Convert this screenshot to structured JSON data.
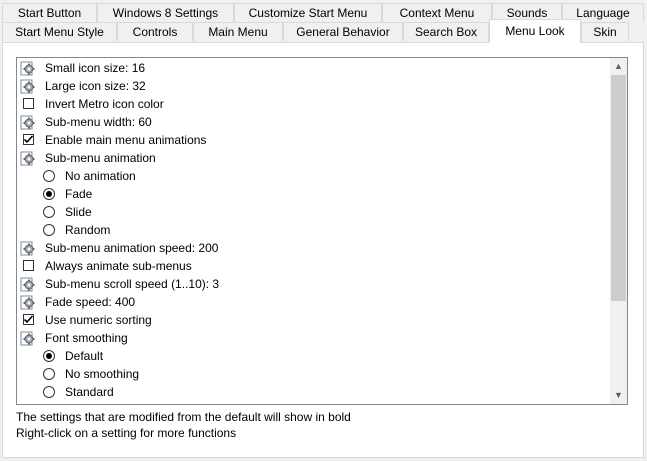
{
  "tabs_top": [
    {
      "label": "Start Button"
    },
    {
      "label": "Windows 8 Settings"
    },
    {
      "label": "Customize Start Menu"
    },
    {
      "label": "Context Menu"
    },
    {
      "label": "Sounds"
    },
    {
      "label": "Language"
    }
  ],
  "tabs_bottom": [
    {
      "label": "Start Menu Style"
    },
    {
      "label": "Controls"
    },
    {
      "label": "Main Menu"
    },
    {
      "label": "General Behavior"
    },
    {
      "label": "Search Box"
    },
    {
      "label": "Menu Look",
      "active": true
    },
    {
      "label": "Skin"
    }
  ],
  "settings": [
    {
      "type": "gear",
      "label": "Small icon size: 16",
      "name": "setting-small-icon-size"
    },
    {
      "type": "gear",
      "label": "Large icon size: 32",
      "name": "setting-large-icon-size"
    },
    {
      "type": "checkbox",
      "checked": false,
      "label": "Invert Metro icon color",
      "name": "setting-invert-metro-icon-color"
    },
    {
      "type": "gear",
      "label": "Sub-menu width: 60",
      "name": "setting-sub-menu-width"
    },
    {
      "type": "checkbox",
      "checked": true,
      "label": "Enable main menu animations",
      "name": "setting-enable-main-menu-animations"
    },
    {
      "type": "gear",
      "label": "Sub-menu animation",
      "name": "setting-sub-menu-animation"
    },
    {
      "type": "radio",
      "selected": false,
      "label": "No animation",
      "name": "option-no-animation"
    },
    {
      "type": "radio",
      "selected": true,
      "label": "Fade",
      "name": "option-fade"
    },
    {
      "type": "radio",
      "selected": false,
      "label": "Slide",
      "name": "option-slide"
    },
    {
      "type": "radio",
      "selected": false,
      "label": "Random",
      "name": "option-random"
    },
    {
      "type": "gear",
      "label": "Sub-menu animation speed: 200",
      "name": "setting-sub-menu-animation-speed"
    },
    {
      "type": "checkbox",
      "checked": false,
      "label": "Always animate sub-menus",
      "name": "setting-always-animate-sub-menus"
    },
    {
      "type": "gear",
      "label": "Sub-menu scroll speed (1..10): 3",
      "name": "setting-sub-menu-scroll-speed"
    },
    {
      "type": "gear",
      "label": "Fade speed: 400",
      "name": "setting-fade-speed"
    },
    {
      "type": "checkbox",
      "checked": true,
      "label": "Use numeric sorting",
      "name": "setting-use-numeric-sorting"
    },
    {
      "type": "gear",
      "label": "Font smoothing",
      "name": "setting-font-smoothing"
    },
    {
      "type": "radio",
      "selected": true,
      "label": "Default",
      "name": "option-default"
    },
    {
      "type": "radio",
      "selected": false,
      "label": "No smoothing",
      "name": "option-no-smoothing"
    },
    {
      "type": "radio",
      "selected": false,
      "label": "Standard",
      "name": "option-standard"
    }
  ],
  "scrollbar": {
    "up_icon": "chevron-up-icon",
    "down_icon": "chevron-down-icon"
  },
  "info": {
    "line1": "The settings that are modified from the default will show in bold",
    "line2": "Right-click on a setting for more functions"
  }
}
